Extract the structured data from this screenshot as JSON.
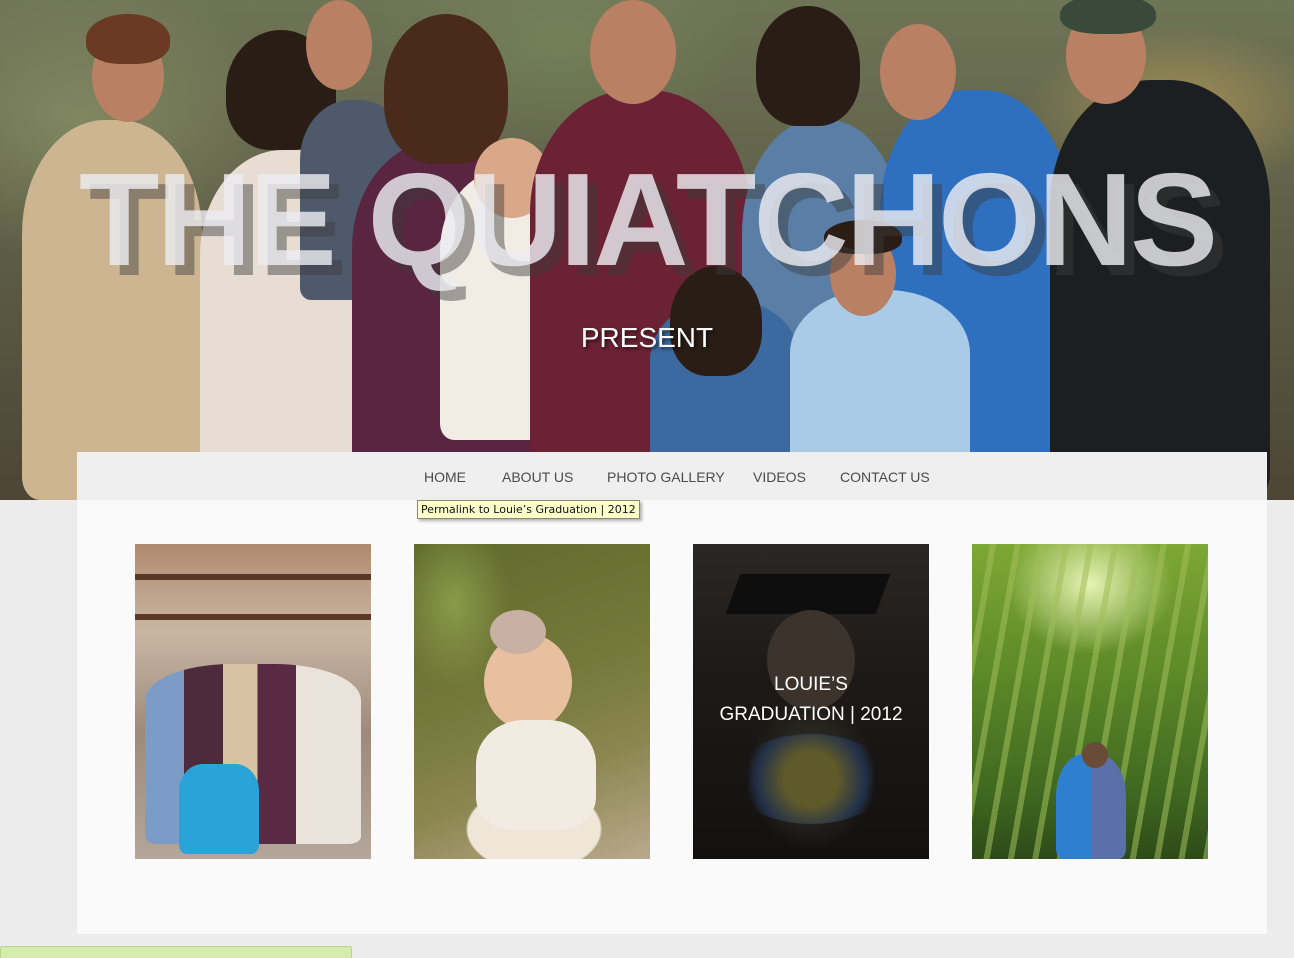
{
  "hero": {
    "title": "THE QUIATCHONS",
    "subtitle": "PRESENT"
  },
  "nav": {
    "items": [
      {
        "label": "HOME"
      },
      {
        "label": "ABOUT US"
      },
      {
        "label": "PHOTO GALLERY"
      },
      {
        "label": "VIDEOS"
      },
      {
        "label": "CONTACT US"
      }
    ]
  },
  "tooltip": {
    "text": "Permalink to Louie’s Graduation | 2012"
  },
  "gallery": {
    "items": [
      {
        "caption_line1": "",
        "caption_line2": ""
      },
      {
        "caption_line1": "",
        "caption_line2": ""
      },
      {
        "caption_line1": "LOUIE’S",
        "caption_line2": "GRADUATION | 2012"
      },
      {
        "caption_line1": "",
        "caption_line2": ""
      }
    ]
  },
  "colors": {
    "page_background": "#ececec",
    "panel_background": "#fafafa",
    "nav_text": "#4a4a4a",
    "tooltip_background": "#ffffcc"
  }
}
